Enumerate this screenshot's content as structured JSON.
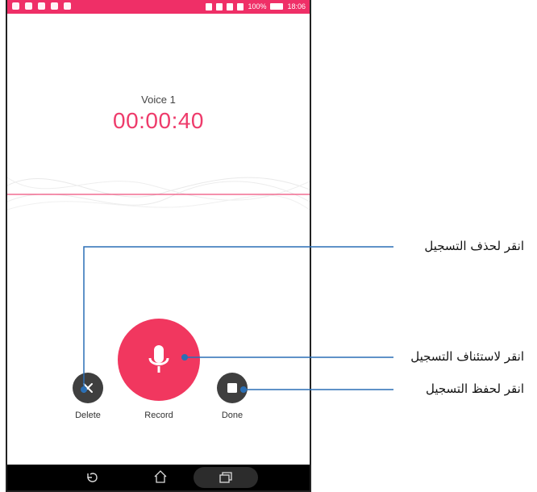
{
  "status_bar": {
    "battery": "100%",
    "time": "18:06"
  },
  "recording": {
    "title": "Voice 1",
    "elapsed": "00:00:40"
  },
  "controls": {
    "delete_label": "Delete",
    "record_label": "Record",
    "done_label": "Done"
  },
  "callouts": {
    "delete": "انقر لحذف التسجيل",
    "resume": "انقر لاستئناف التسجيل",
    "save": "انقر لحفظ التسجيل"
  },
  "colors": {
    "accent": "#ef2f67",
    "button_dark": "#3f3f3f",
    "callout_line": "#2a6fb5"
  },
  "icons": {
    "delete": "close-icon",
    "record": "microphone-icon",
    "done": "stop-icon",
    "nav_back": "back-icon",
    "nav_home": "home-icon",
    "nav_recent": "recent-apps-icon"
  }
}
